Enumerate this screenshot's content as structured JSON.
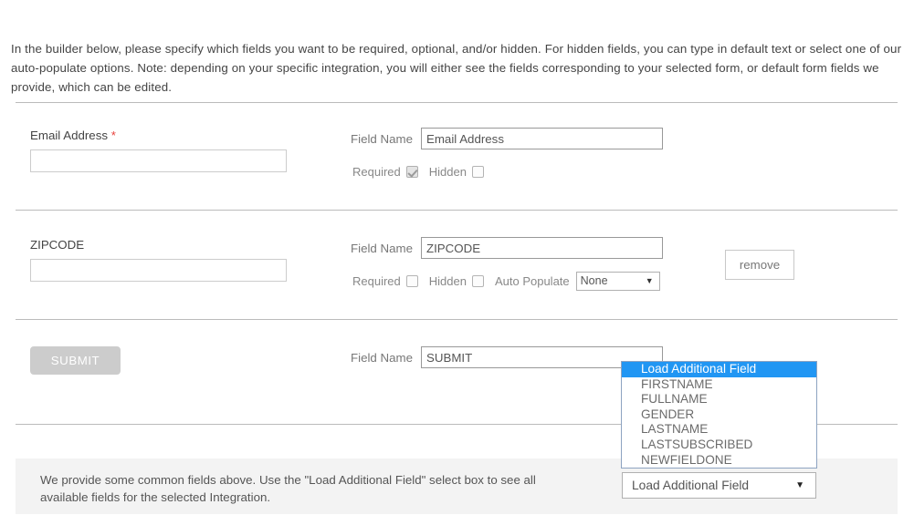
{
  "intro": {
    "text": "In the builder below, please specify which fields you want to be required, optional, and/or hidden. For hidden fields, you can type in default text or select one of our auto-populate options. Note: depending on your specific integration, you will either see the fields corresponding to your selected form, or default form fields we provide, which can be edited."
  },
  "labels": {
    "field_name": "Field Name",
    "required": "Required",
    "hidden": "Hidden",
    "auto_populate": "Auto Populate",
    "remove": "remove",
    "required_star": "*"
  },
  "rows": [
    {
      "preview_label": "Email Address",
      "has_required_star": true,
      "preview_value": "",
      "field_name_value": "Email Address",
      "required_checked": true,
      "required_disabled": true,
      "hidden_checked": false,
      "has_auto_populate": false,
      "has_remove": false,
      "type": "input"
    },
    {
      "preview_label": "ZIPCODE",
      "has_required_star": false,
      "preview_value": "",
      "field_name_value": "ZIPCODE",
      "required_checked": false,
      "required_disabled": false,
      "hidden_checked": false,
      "has_auto_populate": true,
      "auto_populate_value": "None",
      "has_remove": true,
      "type": "input"
    },
    {
      "preview_label": "SUBMIT",
      "has_required_star": false,
      "field_name_value": "SUBMIT",
      "has_checkboxes": false,
      "has_auto_populate": false,
      "has_remove": false,
      "type": "button"
    }
  ],
  "info_panel": {
    "text": "We provide some common fields above. Use the \"Load Additional Field\" select box to see all available fields for the selected Integration."
  },
  "load_field_select": {
    "selected": "Load Additional Field",
    "arrow": "▼",
    "open": true,
    "options": [
      "Load Additional Field",
      "FIRSTNAME",
      "FULLNAME",
      "GENDER",
      "LASTNAME",
      "LASTSUBSCRIBED",
      "NEWFIELDONE"
    ],
    "highlighted_index": 0
  },
  "colors": {
    "highlight_blue": "#2196f3",
    "required_star_red": "#e8413c",
    "submit_grey": "#cccccc",
    "panel_grey": "#f3f3f3",
    "divider_grey": "#bbbbbb"
  }
}
